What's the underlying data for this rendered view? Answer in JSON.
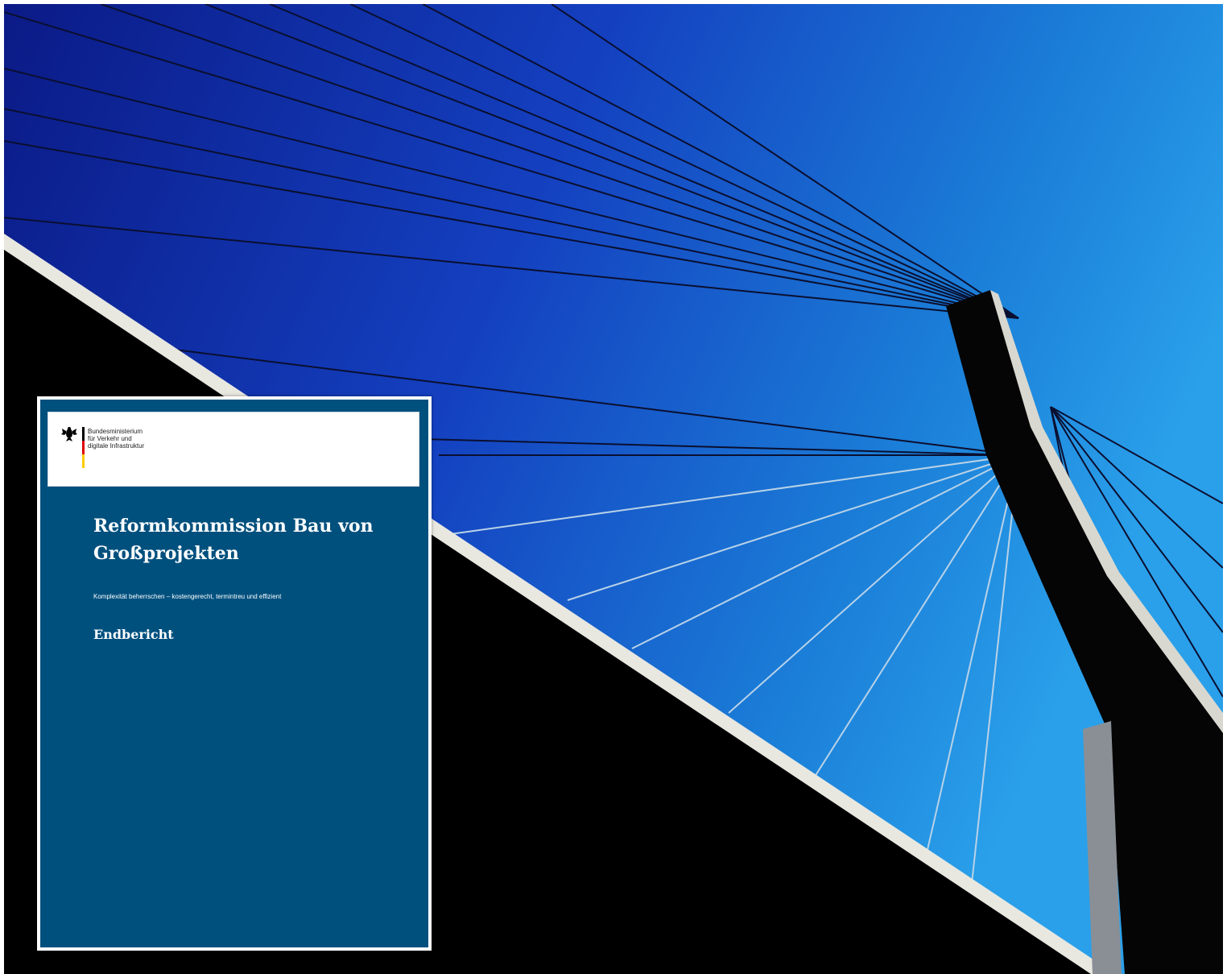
{
  "scene": {
    "description_icon": "cable-stayed-bridge-photo",
    "sky_colors": [
      "#0a1a8a",
      "#1448c8",
      "#1f8ee0"
    ]
  },
  "cover": {
    "ministry_lines": [
      "Bundesministerium",
      "für Verkehr und",
      "digitale Infrastruktur"
    ],
    "title_line1": "Reformkommission Bau von",
    "title_line2": "Großprojekten",
    "subtitle": "Komplexität beherrschen – kostengerecht, termintreu und effizient",
    "report_label": "Endbericht",
    "background_color": "#00507e",
    "flag_colors": [
      "#000000",
      "#dd0000",
      "#ffcc00"
    ]
  }
}
